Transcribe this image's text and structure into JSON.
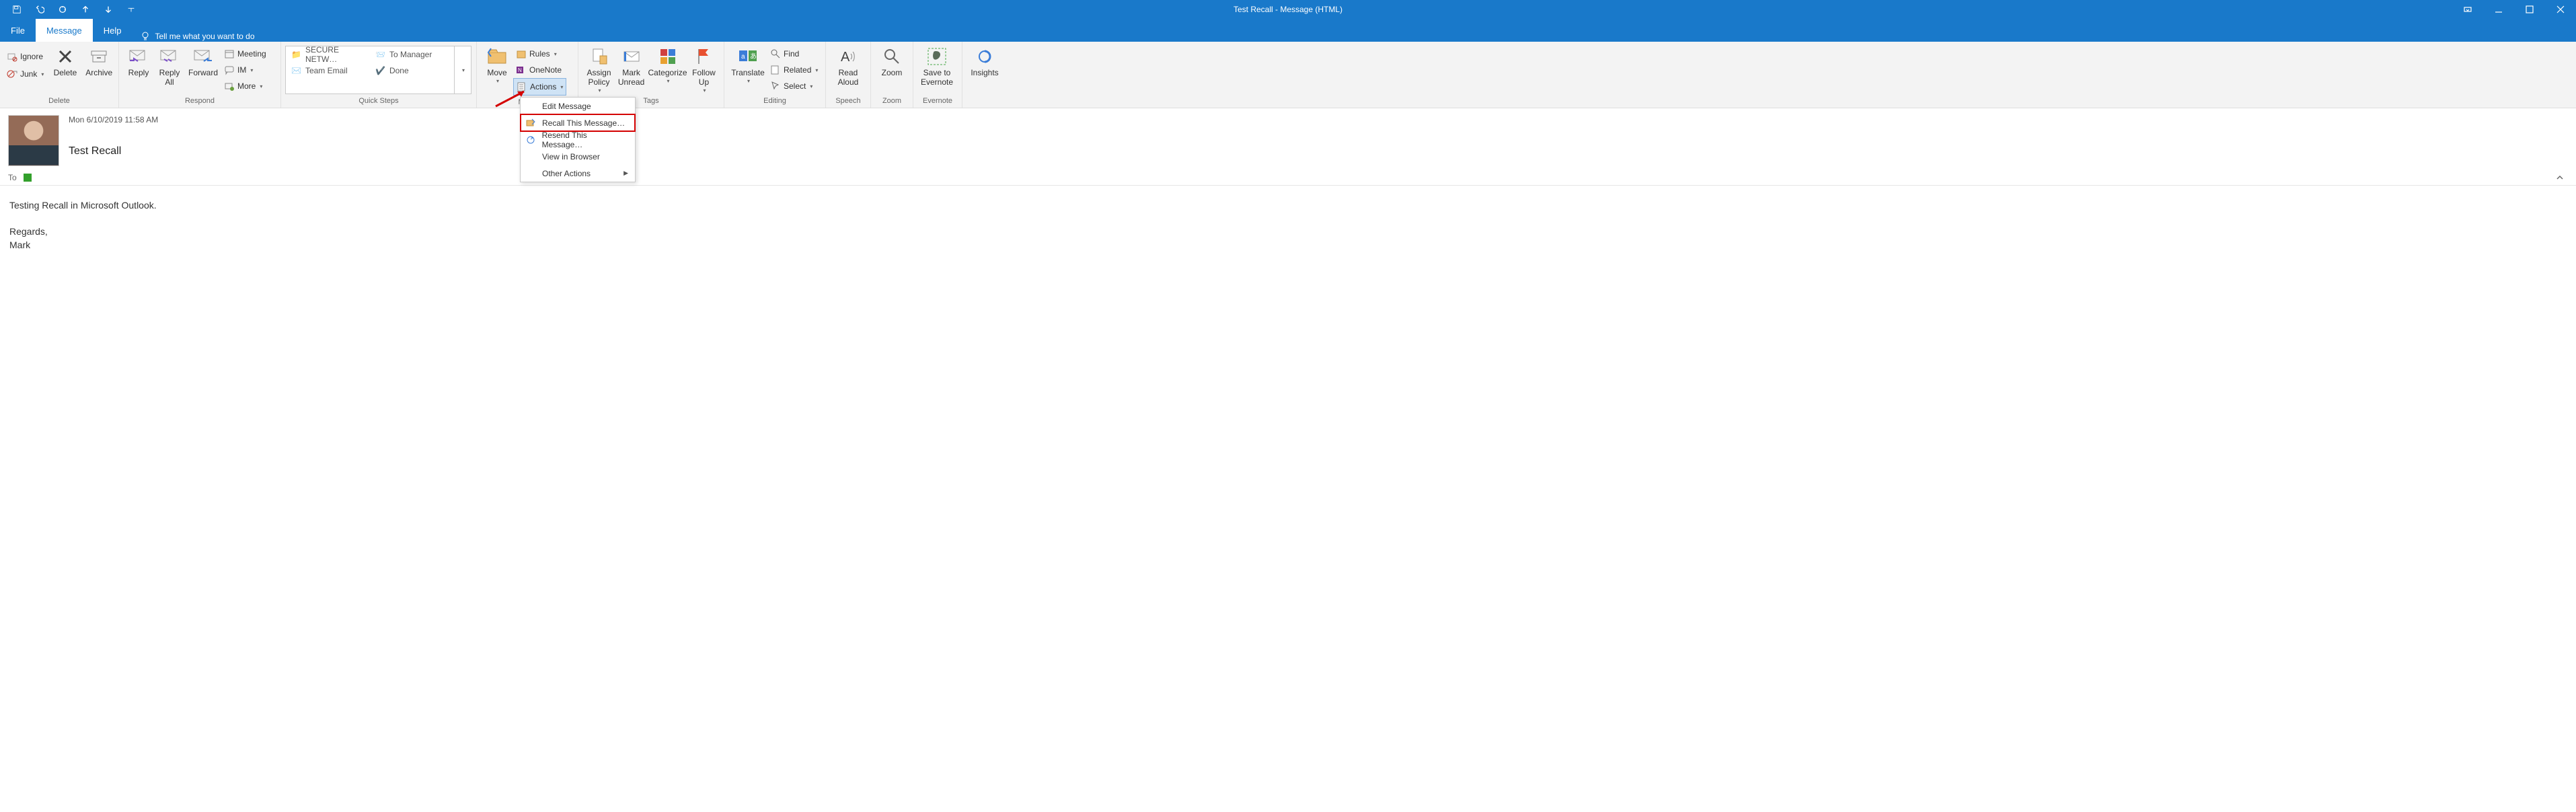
{
  "window": {
    "title": "Test Recall   -  Message (HTML)"
  },
  "tabs": {
    "file": "File",
    "message": "Message",
    "help": "Help",
    "tellme": "Tell me what you want to do"
  },
  "ribbon": {
    "delete": {
      "ignore": "Ignore",
      "junk": "Junk",
      "delete": "Delete",
      "archive": "Archive",
      "group": "Delete"
    },
    "respond": {
      "reply": "Reply",
      "replyall": "Reply\nAll",
      "forward": "Forward",
      "meeting": "Meeting",
      "im": "IM",
      "more": "More",
      "group": "Respond"
    },
    "quicksteps": {
      "secure": "SECURE NETW…",
      "team": "Team Email",
      "manager": "To Manager",
      "done": "Done",
      "group": "Quick Steps"
    },
    "move": {
      "move": "Move",
      "rules": "Rules",
      "onenote": "OneNote",
      "actions": "Actions",
      "group": "Move"
    },
    "tags": {
      "assign": "Assign\nPolicy",
      "mark": "Mark\nUnread",
      "categorize": "Categorize",
      "followup": "Follow\nUp",
      "group": "Tags"
    },
    "editing": {
      "translate": "Translate",
      "find": "Find",
      "related": "Related",
      "select": "Select",
      "group": "Editing"
    },
    "speech": {
      "read": "Read\nAloud",
      "group": "Speech"
    },
    "zoom": {
      "zoom": "Zoom",
      "group": "Zoom"
    },
    "evernote": {
      "save": "Save to\nEvernote",
      "group": "Evernote"
    },
    "insights": {
      "insights": "Insights"
    }
  },
  "actions_menu": {
    "edit": "Edit Message",
    "recall": "Recall This Message…",
    "resend": "Resend This Message…",
    "view": "View in Browser",
    "other": "Other Actions"
  },
  "message": {
    "date": "Mon 6/10/2019 11:58 AM",
    "subject": "Test Recall",
    "to_label": "To",
    "body": "Testing Recall in Microsoft Outlook.\n\nRegards,\nMark"
  }
}
